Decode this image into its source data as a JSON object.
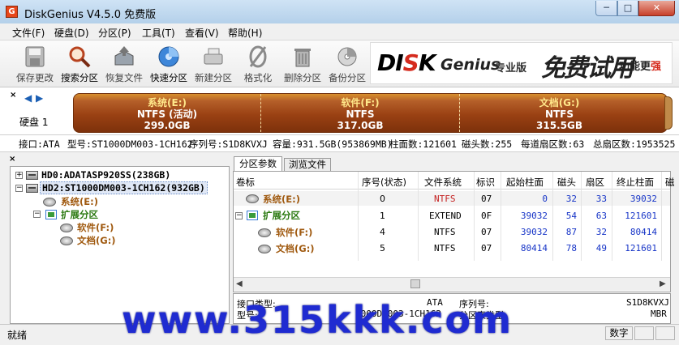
{
  "window": {
    "title": "DiskGenius V4.5.0 免费版",
    "app_icon": "G",
    "min": "─",
    "max": "□",
    "close": "✕"
  },
  "menu": [
    "文件(F)",
    "硬盘(D)",
    "分区(P)",
    "工具(T)",
    "查看(V)",
    "帮助(H)"
  ],
  "toolbar": [
    "保存更改",
    "搜索分区",
    "恢复文件",
    "快速分区",
    "新建分区",
    "格式化",
    "删除分区",
    "备份分区"
  ],
  "banner": {
    "logo_a": "DI",
    "logo_b": "K",
    "logo_genius": "Genius",
    "pro": "专业版",
    "free": "免费试用",
    "more": "功能更",
    "more_red": "强"
  },
  "diskbar": {
    "close": "×",
    "left_arrow": "◀",
    "right_arrow": "▶",
    "label": "硬盘 1",
    "partitions": [
      {
        "name": "系统(E:)",
        "fs": "NTFS (活动)",
        "size": "299.0GB"
      },
      {
        "name": "软件(F:)",
        "fs": "NTFS",
        "size": "317.0GB"
      },
      {
        "name": "文档(G:)",
        "fs": "NTFS",
        "size": "315.5GB"
      }
    ]
  },
  "infoline": [
    "接口:ATA",
    "型号:ST1000DM003-1CH162",
    "序列号:S1D8KVXJ",
    "容量:931.5GB(953869MB)",
    "柱面数:121601",
    "磁头数:255",
    "每道扇区数:63",
    "总扇区数:1953525"
  ],
  "tree": {
    "close": "×",
    "hd0": "HD0:ADATASP920SS(238GB)",
    "hd2": "HD2:ST1000DM003-1CH162(932GB)",
    "sys": "系统(E:)",
    "ext": "扩展分区",
    "soft": "软件(F:)",
    "doc": "文档(G:)",
    "plus": "+",
    "minus": "−"
  },
  "tabs": [
    "分区参数",
    "浏览文件"
  ],
  "table": {
    "headers": [
      "卷标",
      "序号(状态)",
      "文件系统",
      "标识",
      "起始柱面",
      "磁头",
      "扇区",
      "终止柱面",
      "磁"
    ],
    "rows": [
      {
        "label": "系统(E:)",
        "idx": "0",
        "fs": "NTFS",
        "id": "07",
        "start": "0",
        "head": "32",
        "sec": "33",
        "end": "39032"
      },
      {
        "label": "扩展分区",
        "idx": "1",
        "fs": "EXTEND",
        "id": "0F",
        "start": "39032",
        "head": "54",
        "sec": "63",
        "end": "121601"
      },
      {
        "label": "软件(F:)",
        "idx": "4",
        "fs": "NTFS",
        "id": "07",
        "start": "39032",
        "head": "87",
        "sec": "32",
        "end": "80414"
      },
      {
        "label": "文档(G:)",
        "idx": "5",
        "fs": "NTFS",
        "id": "07",
        "start": "80414",
        "head": "78",
        "sec": "49",
        "end": "121601"
      }
    ],
    "collapse": "−"
  },
  "scroll": {
    "left": "◀",
    "right": "▶"
  },
  "details": {
    "iface_label": "接口类型:",
    "iface_value": "ATA",
    "serial_label": "序列号:",
    "serial_value": "S1D8KVXJ",
    "model_label": "型号:",
    "model_value": "1000DM003-1CH162",
    "pt_label": "分区表类型:",
    "pt_value": "MBR"
  },
  "status": {
    "text": "就绪",
    "mode": "数字"
  },
  "watermark": "www.315kkk.com",
  "colors": {
    "partition_bar": "#9a4113",
    "partition_name": "#ffe88a",
    "tree_brown": "#a05a10",
    "tree_green": "#2c7a12",
    "number_blue": "#1634c7",
    "ntfs_red": "#c41f1f",
    "watermark": "#1f2bd1"
  }
}
